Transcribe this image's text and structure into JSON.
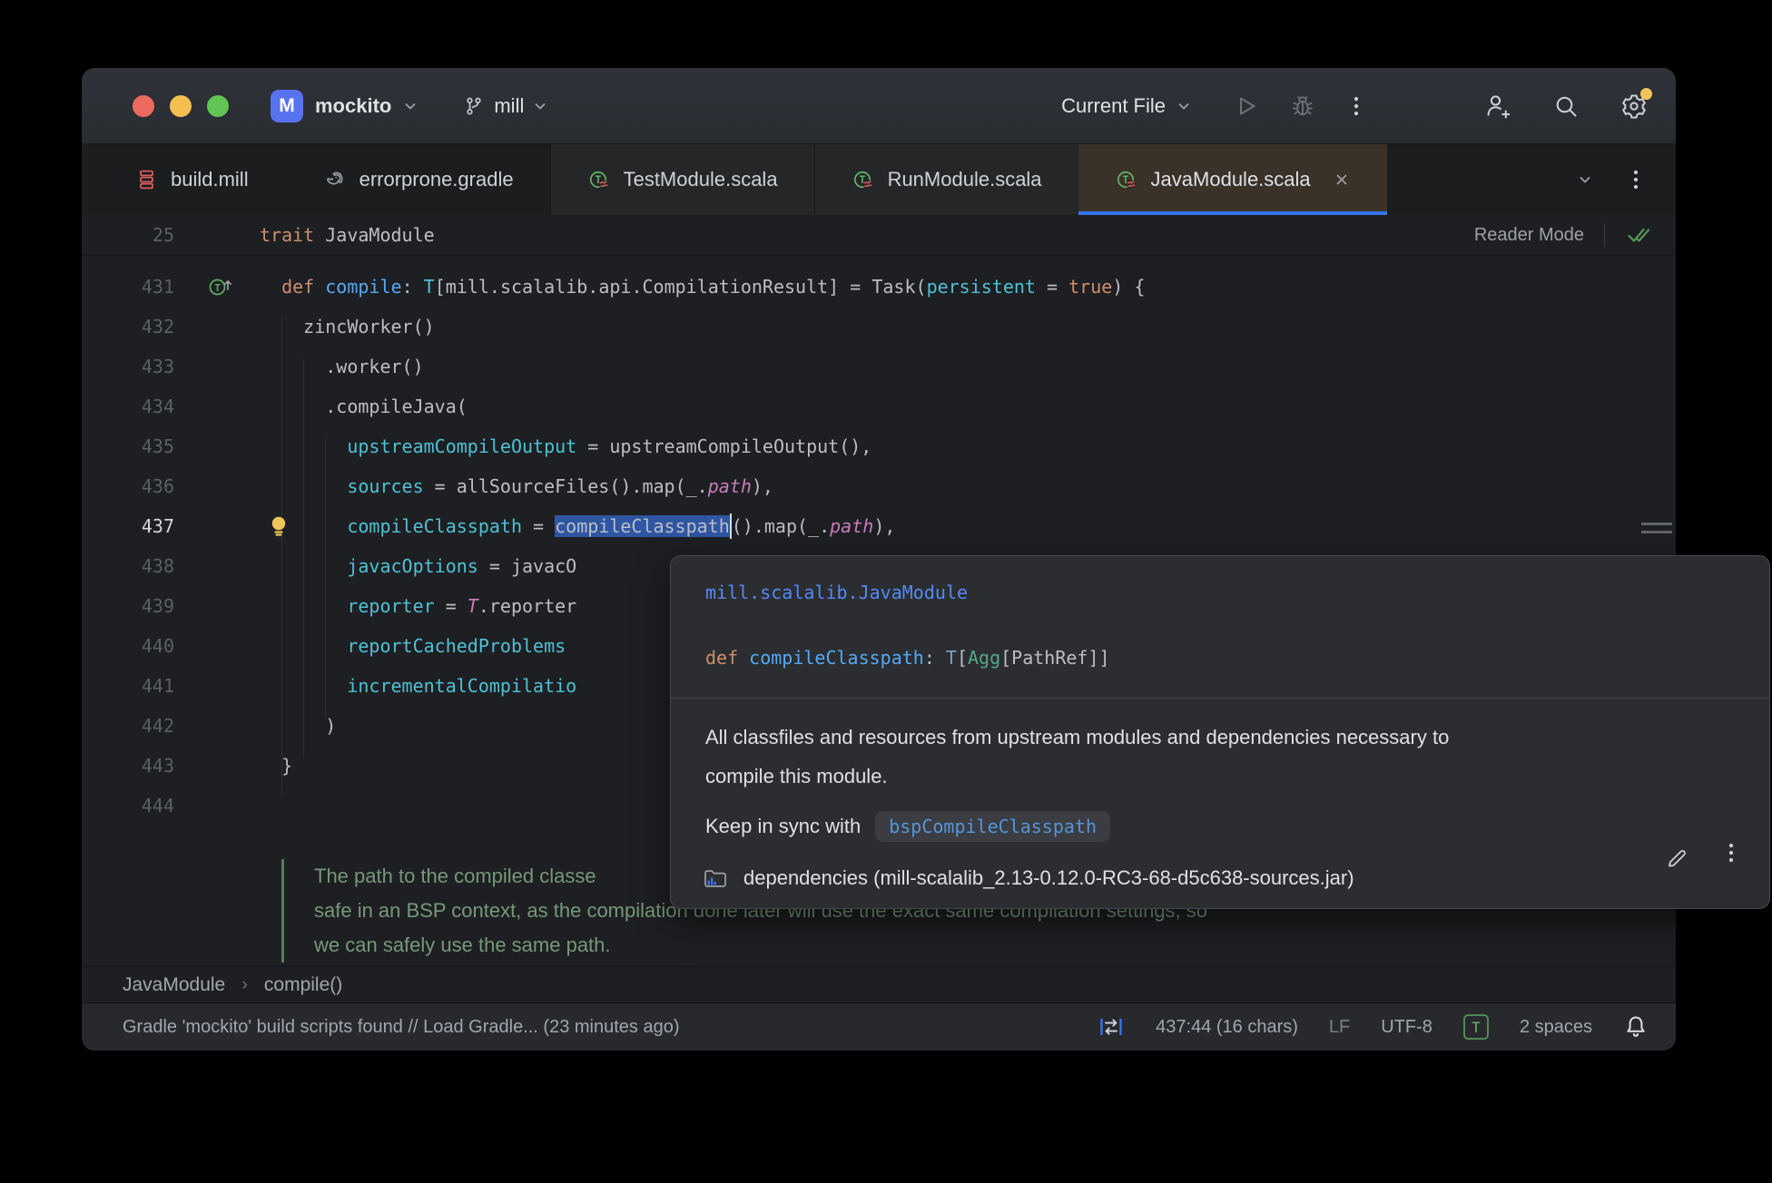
{
  "titlebar": {
    "project": {
      "initial": "M",
      "name": "mockito"
    },
    "branch": "mill",
    "run_config": "Current File"
  },
  "tabbar": {
    "tabs": [
      {
        "label": "build.mill",
        "icon": "mill-build-file-icon",
        "variant": "plain"
      },
      {
        "label": "errorprone.gradle",
        "icon": "gradle-file-icon",
        "variant": "plain"
      },
      {
        "label": "TestModule.scala",
        "icon": "scala-trait-icon",
        "variant": "grouped"
      },
      {
        "label": "RunModule.scala",
        "icon": "scala-trait-icon",
        "variant": "grouped"
      },
      {
        "label": "JavaModule.scala",
        "icon": "scala-trait-icon",
        "variant": "active",
        "close": true
      }
    ]
  },
  "sticky": {
    "line_number": "25",
    "tokens": [
      [
        "kw",
        "trait"
      ],
      [
        "plain",
        " JavaModule"
      ]
    ],
    "reader_mode_label": "Reader Mode"
  },
  "editor": {
    "lines": [
      {
        "num": "431",
        "gutter": "override-icon",
        "tokens": [
          [
            "plain",
            "  "
          ],
          [
            "kw",
            "def"
          ],
          [
            "plain",
            " "
          ],
          [
            "fn",
            "compile"
          ],
          [
            "plain",
            ": "
          ],
          [
            "teal",
            "T"
          ],
          [
            "plain",
            "[mill.scalalib.api.CompilationResult] = Task("
          ],
          [
            "teal",
            "persistent"
          ],
          [
            "plain",
            " = "
          ],
          [
            "kw",
            "true"
          ],
          [
            "plain",
            ") {"
          ]
        ]
      },
      {
        "num": "432",
        "tokens": [
          [
            "plain",
            "    zincWorker()"
          ]
        ]
      },
      {
        "num": "433",
        "tokens": [
          [
            "plain",
            "      .worker()"
          ]
        ]
      },
      {
        "num": "434",
        "tokens": [
          [
            "plain",
            "      .compileJava("
          ]
        ]
      },
      {
        "num": "435",
        "tokens": [
          [
            "plain",
            "        "
          ],
          [
            "teal",
            "upstreamCompileOutput"
          ],
          [
            "plain",
            " = upstreamCompileOutput(),"
          ]
        ]
      },
      {
        "num": "436",
        "tokens": [
          [
            "plain",
            "        "
          ],
          [
            "teal",
            "sources"
          ],
          [
            "plain",
            " = allSourceFiles().map(_."
          ],
          [
            "field",
            "path"
          ],
          [
            "plain",
            "),"
          ]
        ]
      },
      {
        "num": "437",
        "current": true,
        "gutter": "bulb-icon",
        "tokens": [
          [
            "plain",
            "        "
          ],
          [
            "teal",
            "compileClasspath"
          ],
          [
            "plain",
            " = "
          ],
          [
            "sel",
            "compileClasspath"
          ],
          [
            "caret",
            ""
          ],
          [
            "plain",
            "().map(_."
          ],
          [
            "field",
            "path"
          ],
          [
            "plain",
            "),"
          ]
        ]
      },
      {
        "num": "438",
        "tokens": [
          [
            "plain",
            "        "
          ],
          [
            "teal",
            "javacOptions"
          ],
          [
            "plain",
            " = javacO"
          ]
        ]
      },
      {
        "num": "439",
        "tokens": [
          [
            "plain",
            "        "
          ],
          [
            "teal",
            "reporter"
          ],
          [
            "plain",
            " = "
          ],
          [
            "field",
            "T"
          ],
          [
            "plain",
            ".reporter"
          ]
        ]
      },
      {
        "num": "440",
        "tokens": [
          [
            "plain",
            "        "
          ],
          [
            "teal",
            "reportCachedProblems"
          ]
        ]
      },
      {
        "num": "441",
        "tokens": [
          [
            "plain",
            "        "
          ],
          [
            "teal",
            "incrementalCompilatio"
          ]
        ]
      },
      {
        "num": "442",
        "tokens": [
          [
            "plain",
            "      )"
          ]
        ]
      },
      {
        "num": "443",
        "tokens": [
          [
            "plain",
            "  }"
          ]
        ]
      },
      {
        "num": "444",
        "tokens": []
      }
    ],
    "doc_comment": {
      "lines": [
        "The path to the compiled classe",
        "safe in an BSP context, as the compilation done later will use the exact same compilation settings, so",
        "we can safely use the same path."
      ]
    }
  },
  "popup": {
    "qualifier": "mill.scalalib.JavaModule",
    "signature": [
      [
        "kw",
        "def"
      ],
      [
        "plain",
        " "
      ],
      [
        "fn",
        "compileClasspath"
      ],
      [
        "plain",
        ": "
      ],
      [
        "type",
        "T"
      ],
      [
        "plain",
        "["
      ],
      [
        "agg",
        "Agg"
      ],
      [
        "plain",
        "[PathRef]]"
      ]
    ],
    "description": [
      "All classfiles and resources from upstream modules and dependencies necessary to",
      "compile this module."
    ],
    "sync_label": "Keep in sync with",
    "sync_code": "bspCompileClasspath",
    "source": "dependencies (mill-scalalib_2.13-0.12.0-RC3-68-d5c638-sources.jar)"
  },
  "breadcrumbs": {
    "items": [
      "JavaModule",
      "compile()"
    ],
    "separator": "›"
  },
  "statusbar": {
    "message": "Gradle 'mockito' build scripts found // Load Gradle... (23 minutes ago)",
    "position": "437:44 (16 chars)",
    "line_ending": "LF",
    "encoding": "UTF-8",
    "badge": "T",
    "indent": "2 spaces"
  },
  "colors": {
    "accent": "#3574F0",
    "selection": "#2E56A3",
    "keyword": "#CF8E6D",
    "function": "#56A8F5",
    "named_argument": "#4EC1D6",
    "field": "#C77DBB",
    "doc_comment": "#76987A",
    "active_tab_bg": "#3A3128",
    "editor_bg": "#1E1F22"
  }
}
